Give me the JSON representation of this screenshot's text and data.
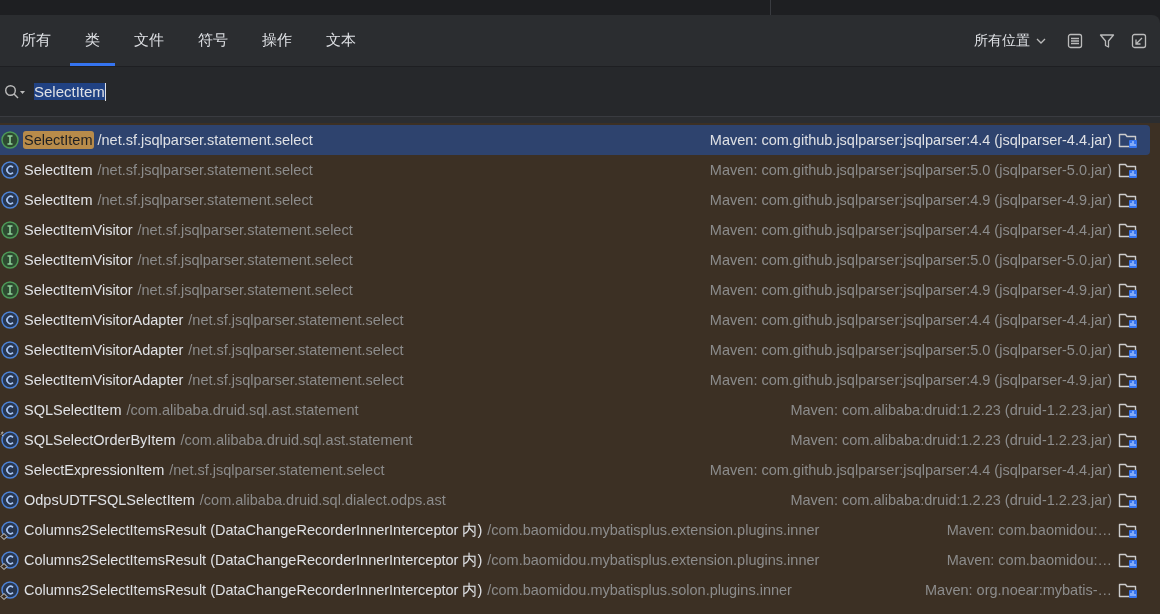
{
  "tabs": [
    {
      "label": "所有",
      "selected": false
    },
    {
      "label": "类",
      "selected": true
    },
    {
      "label": "文件",
      "selected": false
    },
    {
      "label": "符号",
      "selected": false
    },
    {
      "label": "操作",
      "selected": false
    },
    {
      "label": "文本",
      "selected": false
    }
  ],
  "scope": {
    "label": "所有位置"
  },
  "search": {
    "value": "SelectItem"
  },
  "results": [
    {
      "kind": "interface",
      "name": "SelectItem",
      "path": "/net.sf.jsqlparser.statement.select",
      "module": "Maven: com.github.jsqlparser:jsqlparser:4.4 (jsqlparser-4.4.jar)",
      "selected": true
    },
    {
      "kind": "class",
      "name": "SelectItem",
      "path": "/net.sf.jsqlparser.statement.select",
      "module": "Maven: com.github.jsqlparser:jsqlparser:5.0 (jsqlparser-5.0.jar)",
      "selected": false
    },
    {
      "kind": "class",
      "name": "SelectItem",
      "path": "/net.sf.jsqlparser.statement.select",
      "module": "Maven: com.github.jsqlparser:jsqlparser:4.9 (jsqlparser-4.9.jar)",
      "selected": false
    },
    {
      "kind": "interface",
      "name": "SelectItemVisitor",
      "path": "/net.sf.jsqlparser.statement.select",
      "module": "Maven: com.github.jsqlparser:jsqlparser:4.4 (jsqlparser-4.4.jar)",
      "selected": false
    },
    {
      "kind": "interface",
      "name": "SelectItemVisitor",
      "path": "/net.sf.jsqlparser.statement.select",
      "module": "Maven: com.github.jsqlparser:jsqlparser:5.0 (jsqlparser-5.0.jar)",
      "selected": false
    },
    {
      "kind": "interface",
      "name": "SelectItemVisitor",
      "path": "/net.sf.jsqlparser.statement.select",
      "module": "Maven: com.github.jsqlparser:jsqlparser:4.9 (jsqlparser-4.9.jar)",
      "selected": false
    },
    {
      "kind": "class",
      "name": "SelectItemVisitorAdapter",
      "path": "/net.sf.jsqlparser.statement.select",
      "module": "Maven: com.github.jsqlparser:jsqlparser:4.4 (jsqlparser-4.4.jar)",
      "selected": false
    },
    {
      "kind": "class",
      "name": "SelectItemVisitorAdapter",
      "path": "/net.sf.jsqlparser.statement.select",
      "module": "Maven: com.github.jsqlparser:jsqlparser:5.0 (jsqlparser-5.0.jar)",
      "selected": false
    },
    {
      "kind": "class",
      "name": "SelectItemVisitorAdapter",
      "path": "/net.sf.jsqlparser.statement.select",
      "module": "Maven: com.github.jsqlparser:jsqlparser:4.9 (jsqlparser-4.9.jar)",
      "selected": false
    },
    {
      "kind": "class",
      "name": "SQLSelectItem",
      "path": "/com.alibaba.druid.sql.ast.statement",
      "module": "Maven: com.alibaba:druid:1.2.23 (druid-1.2.23.jar)",
      "selected": false
    },
    {
      "kind": "linked-class",
      "name": "SQLSelectOrderByItem",
      "path": "/com.alibaba.druid.sql.ast.statement",
      "module": "Maven: com.alibaba:druid:1.2.23 (druid-1.2.23.jar)",
      "selected": false
    },
    {
      "kind": "class",
      "name": "SelectExpressionItem",
      "path": "/net.sf.jsqlparser.statement.select",
      "module": "Maven: com.github.jsqlparser:jsqlparser:4.4 (jsqlparser-4.4.jar)",
      "selected": false
    },
    {
      "kind": "class",
      "name": "OdpsUDTFSQLSelectItem",
      "path": "/com.alibaba.druid.sql.dialect.odps.ast",
      "module": "Maven: com.alibaba:druid:1.2.23 (druid-1.2.23.jar)",
      "selected": false
    },
    {
      "kind": "inner-class",
      "name": "Columns2SelectItemsResult (DataChangeRecorderInnerInterceptor 内)",
      "path": "/com.baomidou.mybatisplus.extension.plugins.inner",
      "module": "Maven: com.baomidou:…",
      "selected": false
    },
    {
      "kind": "inner-class",
      "name": "Columns2SelectItemsResult (DataChangeRecorderInnerInterceptor 内)",
      "path": "/com.baomidou.mybatisplus.extension.plugins.inner",
      "module": "Maven: com.baomidou:…",
      "selected": false
    },
    {
      "kind": "inner-class",
      "name": "Columns2SelectItemsResult (DataChangeRecorderInnerInterceptor 内)",
      "path": "/com.baomidou.mybatisplus.solon.plugins.inner",
      "module": "Maven: org.noear:mybatis-…",
      "selected": false
    }
  ]
}
